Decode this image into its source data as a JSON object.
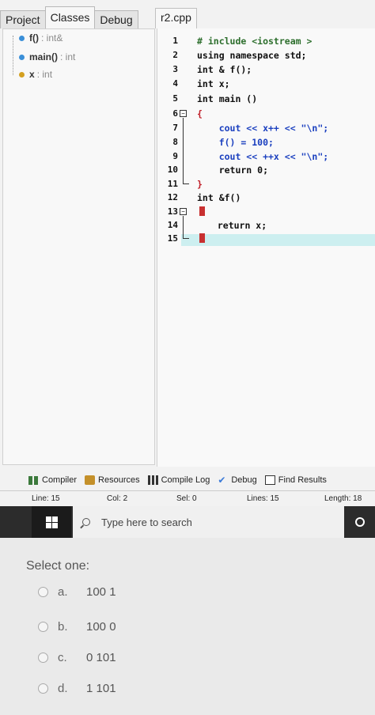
{
  "ide": {
    "left_tabs": [
      "Project",
      "Classes",
      "Debug"
    ],
    "file_tab": "r2.cpp",
    "class_tree": [
      {
        "name": "f()",
        "type": ": int&",
        "color": "#3a8fd8"
      },
      {
        "name": "main()",
        "type": ": int",
        "color": "#3a8fd8"
      },
      {
        "name": "x",
        "type": ": int",
        "color": "#d4a020"
      }
    ],
    "line_numbers": [
      "1",
      "2",
      "3",
      "4",
      "5",
      "6",
      "7",
      "8",
      "9",
      "10",
      "11",
      "12",
      "13",
      "14",
      "15"
    ],
    "code": [
      "# include <iostream >",
      "using namespace std;",
      "int & f();",
      "int x;",
      "int main ()",
      "{",
      "    cout << x++ << \"\\n\";",
      "    f() = 100;",
      "    cout << ++x << \"\\n\";",
      "    return 0;",
      "}",
      "int &f()",
      "{",
      "  return x;",
      "}"
    ],
    "toolbar": [
      {
        "label": "Compiler",
        "icon": "compiler-icon"
      },
      {
        "label": "Resources",
        "icon": "resources-icon"
      },
      {
        "label": "Compile Log",
        "icon": "compile-log-icon"
      },
      {
        "label": "Debug",
        "icon": "debug-check-icon"
      },
      {
        "label": "Find Results",
        "icon": "find-icon"
      }
    ],
    "status": {
      "line_label": "Line:",
      "line": "15",
      "col_label": "Col:",
      "col": "2",
      "sel_label": "Sel:",
      "sel": "0",
      "lines_label": "Lines:",
      "lines": "15",
      "length_label": "Length:",
      "length": "18"
    }
  },
  "taskbar": {
    "search_placeholder": "Type here to search"
  },
  "quiz": {
    "prompt": "Select one:",
    "options": [
      {
        "letter": "a.",
        "text": "100 1"
      },
      {
        "letter": "b.",
        "text": "100 0"
      },
      {
        "letter": "c.",
        "text": "0 101"
      },
      {
        "letter": "d.",
        "text": "1 101"
      }
    ]
  }
}
